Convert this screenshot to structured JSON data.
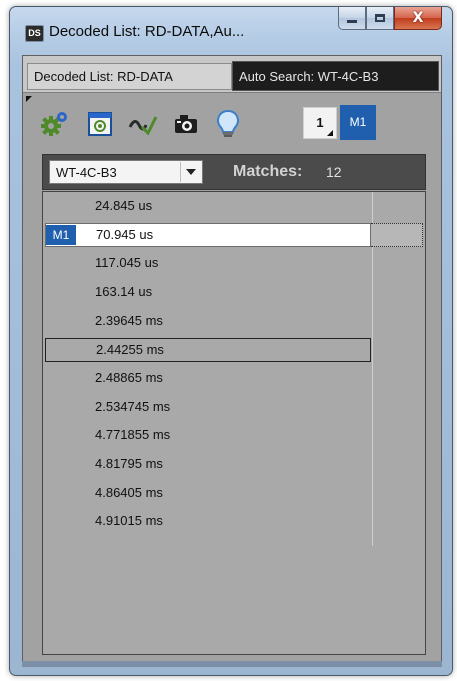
{
  "window": {
    "app_icon": "DS",
    "title": "Decoded List: RD-DATA,Au...",
    "close_glyph": "X"
  },
  "tabs": [
    {
      "label": "Decoded List: RD-DATA",
      "active": false
    },
    {
      "label": "Auto Search: WT-4C-B3",
      "active": true
    }
  ],
  "toolbar": {
    "icons": [
      "gear-icon",
      "screen-capture-icon",
      "waveform-check-icon",
      "camera-icon",
      "lightbulb-icon"
    ],
    "number_button": "1",
    "marker_button": "M1",
    "accent": "#1f5fae"
  },
  "search": {
    "selected_value": "WT-4C-B3",
    "matches_label": "Matches:",
    "matches_count": "12"
  },
  "results": [
    {
      "value": "24.845 us",
      "marker": ""
    },
    {
      "value": "70.945 us",
      "marker": "M1"
    },
    {
      "value": "117.045 us",
      "marker": ""
    },
    {
      "value": "163.14 us",
      "marker": ""
    },
    {
      "value": "2.39645 ms",
      "marker": ""
    },
    {
      "value": "2.44255 ms",
      "marker": ""
    },
    {
      "value": "2.48865 ms",
      "marker": ""
    },
    {
      "value": "2.534745 ms",
      "marker": ""
    },
    {
      "value": "4.771855 ms",
      "marker": ""
    },
    {
      "value": "4.81795 ms",
      "marker": ""
    },
    {
      "value": "4.86405 ms",
      "marker": ""
    },
    {
      "value": "4.91015 ms",
      "marker": ""
    }
  ]
}
